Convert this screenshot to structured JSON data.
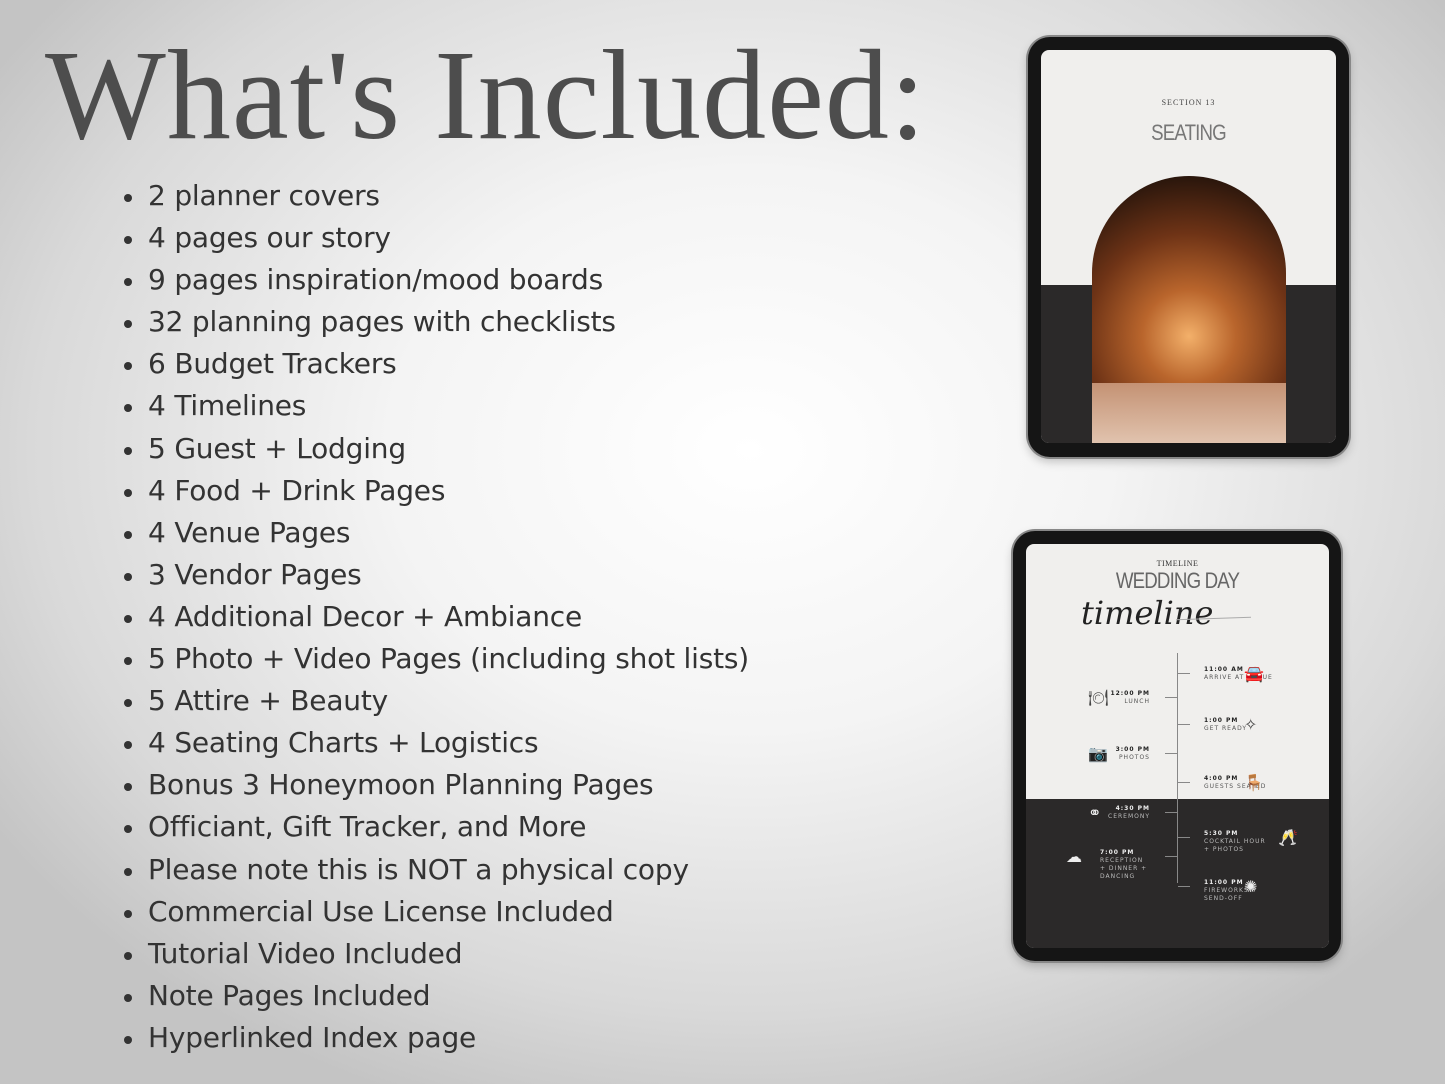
{
  "title": "What's Included:",
  "items": [
    "2 planner covers",
    "4 pages our story",
    "9 pages inspiration/mood boards",
    "32 planning pages with checklists",
    "6 Budget Trackers",
    "4 Timelines",
    "5 Guest + Lodging",
    "4 Food + Drink Pages",
    "4 Venue Pages",
    "3 Vendor Pages",
    "4 Additional Decor + Ambiance",
    "5 Photo + Video Pages (including shot lists)",
    "5 Attire + Beauty",
    "4 Seating Charts + Logistics",
    "Bonus 3 Honeymoon Planning Pages",
    "Officiant, Gift Tracker, and More",
    "Please note this is NOT a physical copy",
    "Commercial Use License Included",
    "Tutorial Video Included",
    "Note Pages Included",
    "Hyperlinked Index page"
  ],
  "tablet1": {
    "section": "SECTION 13",
    "heading": "SEATING"
  },
  "tablet2": {
    "label": "TIMELINE",
    "heading": "WEDDING DAY",
    "script": "timeline",
    "events": [
      {
        "time": "11:00 AM",
        "text": "ARRIVE AT VENUE",
        "icon": "car-icon"
      },
      {
        "time": "12:00 PM",
        "text": "LUNCH",
        "icon": "plate-icon"
      },
      {
        "time": "1:00 PM",
        "text": "GET READY",
        "icon": "perfume-icon"
      },
      {
        "time": "3:00 PM",
        "text": "PHOTOS",
        "icon": "camera-icon"
      },
      {
        "time": "4:00 PM",
        "text": "GUESTS SEATED",
        "icon": "chair-icon"
      },
      {
        "time": "4:30 PM",
        "text": "CEREMONY",
        "icon": "rings-icon"
      },
      {
        "time": "5:30 PM",
        "text": "COCKTAIL HOUR + PHOTOS",
        "icon": "champagne-icon"
      },
      {
        "time": "7:00 PM",
        "text": "RECEPTION + DINNER + DANCING",
        "icon": "cloche-icon"
      },
      {
        "time": "11:00 PM",
        "text": "FIREWORKS + SEND-OFF",
        "icon": "fireworks-icon"
      }
    ]
  },
  "colors": {
    "text": "#333333",
    "dark_panel": "#2b2929",
    "screen": "#f0efed"
  }
}
